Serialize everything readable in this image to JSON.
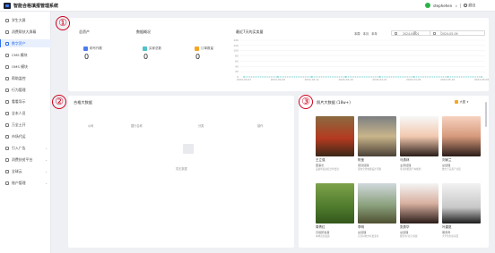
{
  "app": {
    "title": "智能合格填报管理系统"
  },
  "user": {
    "name": "stephehen",
    "chevron": "∨",
    "logout": "退出"
  },
  "sidebar": {
    "items": [
      {
        "label": "学生大屏"
      },
      {
        "label": "消费帮扶大屏幕"
      },
      {
        "label": "数字资产"
      },
      {
        "label": "CMS 模块"
      },
      {
        "label": "OMS 模块"
      },
      {
        "label": "帮助监控"
      },
      {
        "label": "行为管理"
      },
      {
        "label": "看看导示"
      },
      {
        "label": "全本人员"
      },
      {
        "label": "万全土开"
      },
      {
        "label": "市场代运"
      },
      {
        "label": "引入广告"
      },
      {
        "label": "消费扶贫平台"
      },
      {
        "label": "全球云"
      },
      {
        "label": "账户管理"
      }
    ]
  },
  "annotations": [
    "①",
    "②",
    "③"
  ],
  "assets": {
    "title": "总资产",
    "overview_title": "数据概况",
    "stats": [
      {
        "label": "助写作数",
        "value": "0",
        "color": "#4a7cf0"
      },
      {
        "label": "买家总数",
        "value": "0",
        "color": "#4fc3c7"
      },
      {
        "label": "订单数量",
        "value": "0",
        "color": "#f5a623"
      }
    ]
  },
  "chart_head": "最近7天的买卖量",
  "segments": [
    "本周",
    "本月",
    "本年"
  ],
  "date_range": {
    "start": "2024-04-01",
    "end": "2024-05-09",
    "separator": "至"
  },
  "chart_data": {
    "type": "line",
    "title": "最近7天的买卖量",
    "x": [
      "2024-04-01",
      "2024-04-06",
      "2024-04-11",
      "2024-04-16",
      "2024-04-21",
      "2024-04-26",
      "2024-05-01",
      "2024-05-06"
    ],
    "series": [
      {
        "values": [
          0,
          0,
          0,
          0,
          0,
          0,
          0,
          0
        ]
      }
    ],
    "yticks": [
      "140",
      "120",
      "100",
      "80",
      "60",
      "40",
      "20",
      "0"
    ],
    "ylim": [
      0,
      140
    ],
    "grid": true,
    "color": "#4fc3c7"
  },
  "assets_big": {
    "title": "合格大数据",
    "columns": [
      "公司",
      "银行名称",
      "分类",
      "操作"
    ],
    "empty_text": "暂无数据"
  },
  "photos": {
    "title": "照片大数据",
    "count": "(18w+)",
    "select_label": "大图",
    "items": [
      {
        "name": "王立强",
        "role": "董事长",
        "desc": "设备年度总结全年会议",
        "bg": "linear-gradient(180deg,#8a6a40,#b43a20 55%,#3a2818)"
      },
      {
        "name": "陈莹",
        "role": "项目经理",
        "desc": "现在全景电器设计问题",
        "bg": "linear-gradient(180deg,#7c7f82,#c9b58a 50%,#4a4036)"
      },
      {
        "name": "马勇林",
        "role": "业务经理",
        "desc": "专注新能源汽车规划",
        "bg": "linear-gradient(180deg,#f7f7f7,#f2c9b0 50%,#2a1c18)"
      },
      {
        "name": "刘家兰",
        "role": "总经理",
        "desc": "致力于完善产业链",
        "bg": "linear-gradient(180deg,#f7d2c0,#d69a7c 50%,#2a1c18)"
      },
      {
        "name": "周青红",
        "role": "高级研发者",
        "desc": "本地农业发展",
        "bg": "linear-gradient(180deg,#7da24a,#4e7a2c 60%,#33561c)"
      },
      {
        "name": "李明",
        "role": "总经理",
        "desc": "让农村地方有更多色",
        "bg": "linear-gradient(180deg,#d0d8dc,#8aa07c 55%,#4e5030)"
      },
      {
        "name": "张秀华",
        "role": "总经理",
        "desc": "我们的'北京'前提",
        "bg": "linear-gradient(180deg,#f4f4f4,#d8b0a0 50%,#2a1c18)"
      },
      {
        "name": "叶建夏",
        "role": "服务商",
        "desc": "大学生创业项目",
        "bg": "linear-gradient(180deg,#f2f2f2,#c8c8c8 60%,#1c1c1c)"
      }
    ]
  }
}
